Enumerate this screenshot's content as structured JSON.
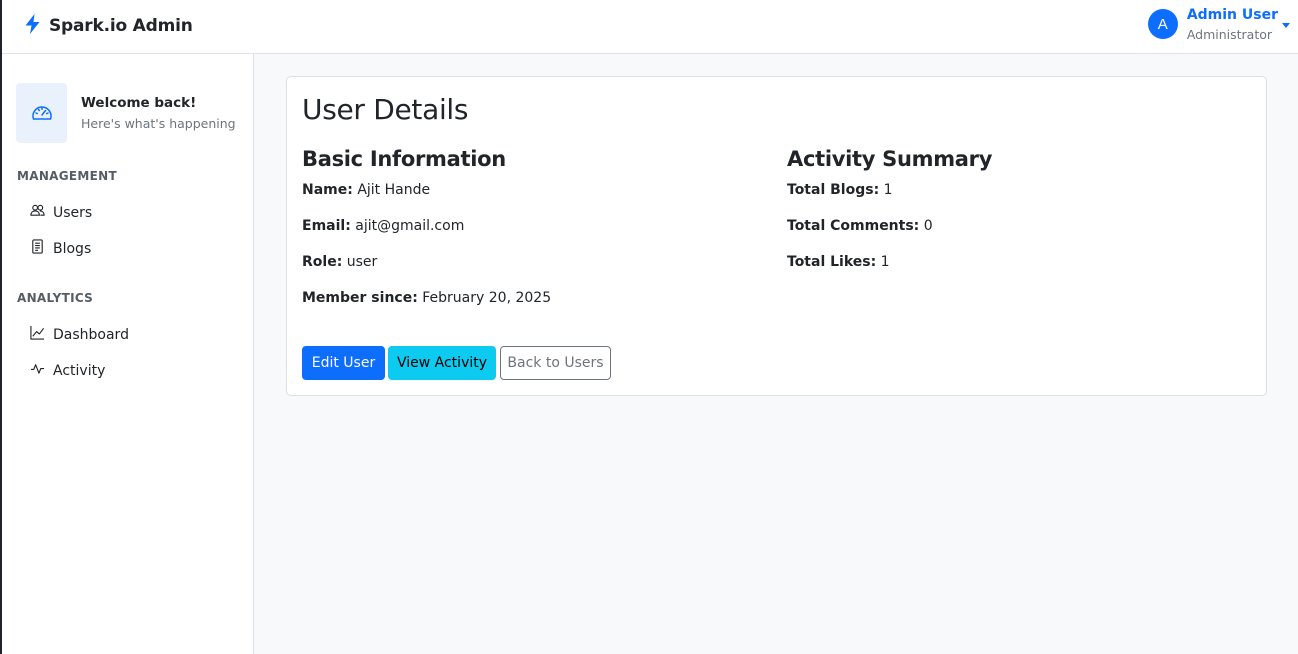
{
  "brand": {
    "name": "Spark.io Admin",
    "icon": "lightning-icon"
  },
  "user_menu": {
    "avatar_initial": "A",
    "name": "Admin User",
    "role": "Administrator"
  },
  "sidebar": {
    "welcome": {
      "title": "Welcome back!",
      "subtitle": "Here's what's happening",
      "icon": "speedometer-icon"
    },
    "sections": [
      {
        "title": "MANAGEMENT",
        "items": [
          {
            "label": "Users",
            "icon": "people-icon"
          },
          {
            "label": "Blogs",
            "icon": "document-icon"
          }
        ]
      },
      {
        "title": "ANALYTICS",
        "items": [
          {
            "label": "Dashboard",
            "icon": "line-chart-icon"
          },
          {
            "label": "Activity",
            "icon": "pulse-icon"
          }
        ]
      }
    ]
  },
  "main": {
    "title": "User Details",
    "basic_info": {
      "title": "Basic Information",
      "fields": [
        {
          "label": "Name:",
          "value": "Ajit Hande"
        },
        {
          "label": "Email:",
          "value": "ajit@gmail.com"
        },
        {
          "label": "Role:",
          "value": "user"
        },
        {
          "label": "Member since:",
          "value": "February 20, 2025"
        }
      ]
    },
    "activity": {
      "title": "Activity Summary",
      "fields": [
        {
          "label": "Total Blogs:",
          "value": "1"
        },
        {
          "label": "Total Comments:",
          "value": "0"
        },
        {
          "label": "Total Likes:",
          "value": "1"
        }
      ]
    },
    "buttons": {
      "edit": "Edit User",
      "view": "View Activity",
      "back": "Back to Users"
    }
  },
  "colors": {
    "primary": "#0d6efd",
    "info": "#0dcaf0",
    "secondary": "#6c757d",
    "background": "#f8f9fa"
  }
}
